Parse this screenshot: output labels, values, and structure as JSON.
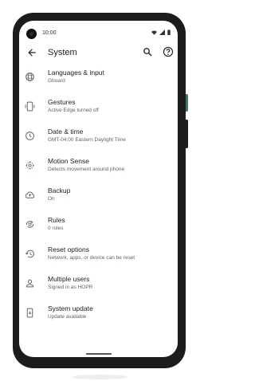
{
  "status_bar": {
    "time": "10:00"
  },
  "toolbar": {
    "title": "System"
  },
  "items": [
    {
      "label": "Languages & input",
      "sub": "Gboard",
      "icon": "globe-icon"
    },
    {
      "label": "Gestures",
      "sub": "Active Edge turned off",
      "icon": "phone-gesture-icon"
    },
    {
      "label": "Date & time",
      "sub": "GMT-04:00 Eastern Daylight Time",
      "icon": "clock-icon"
    },
    {
      "label": "Motion Sense",
      "sub": "Detects movement around phone",
      "icon": "motion-sense-icon"
    },
    {
      "label": "Backup",
      "sub": "On",
      "icon": "cloud-upload-icon"
    },
    {
      "label": "Rules",
      "sub": "0 rules",
      "icon": "rules-icon"
    },
    {
      "label": "Reset options",
      "sub": "Network, apps, or device can be reset",
      "icon": "history-icon"
    },
    {
      "label": "Multiple users",
      "sub": "Signed in as HOPR",
      "icon": "person-icon"
    },
    {
      "label": "System update",
      "sub": "Update available",
      "icon": "system-update-icon"
    }
  ]
}
